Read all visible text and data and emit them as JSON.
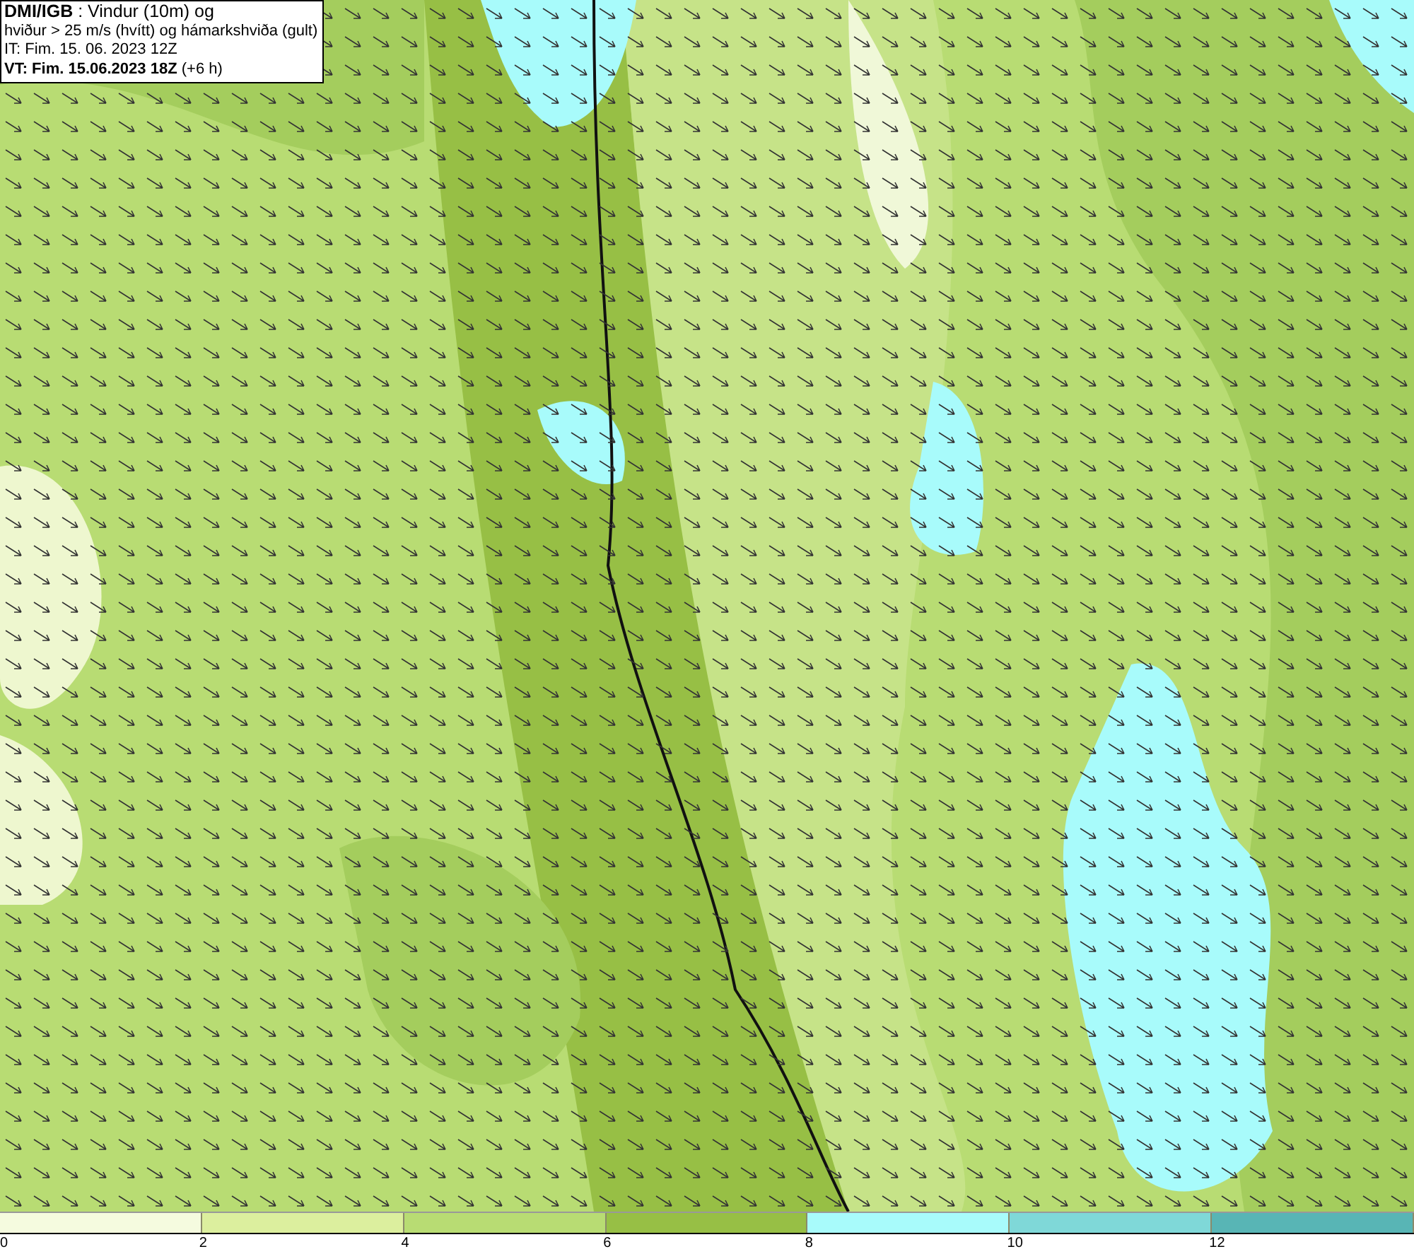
{
  "title_box": {
    "lines": [
      "**DMI/IGB** : Vindur (10m) og",
      "hviður > 25 m/s (hvítt) og hámarkshviða (gult)",
      "IT: Fim. 15. 06. 2023 12Z",
      "**VT: Fim. 15.06.2023 18Z** (+6 h)"
    ]
  },
  "legend": {
    "segments": [
      {
        "label": "0",
        "color": "#f5fbdf"
      },
      {
        "label": "2",
        "color": "#dcef9e"
      },
      {
        "label": "4",
        "color": "#b8dc73"
      },
      {
        "label": "6",
        "color": "#97bf45"
      },
      {
        "label": "8",
        "color": "#a8fbfb"
      },
      {
        "label": "10",
        "color": "#7fd8d8"
      },
      {
        "label": "12",
        "color": "#58b5b5"
      }
    ]
  }
}
